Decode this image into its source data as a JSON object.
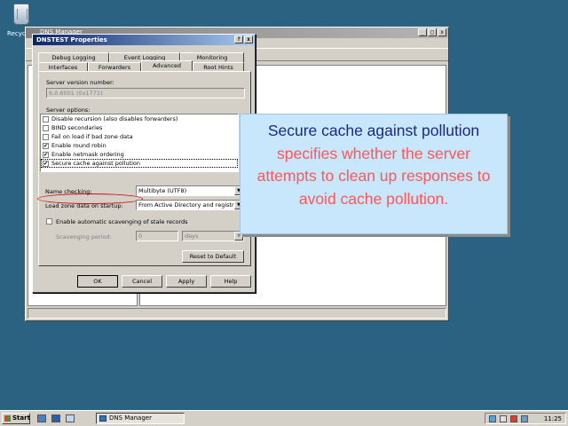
{
  "desktop": {
    "recycle_label": "Recycle Bin"
  },
  "mmc": {
    "title": "DNS Manager"
  },
  "dialog": {
    "title": "DNSTEST Properties",
    "tabs_row1": [
      "Debug Logging",
      "Event Logging",
      "Monitoring"
    ],
    "tabs_row2": [
      "Interfaces",
      "Forwarders",
      "Advanced",
      "Root Hints"
    ],
    "active_tab": "Advanced",
    "server_version_label": "Server version number:",
    "server_version_value": "6.0.6001 (0x1771)",
    "server_options_label": "Server options:",
    "options": [
      {
        "label": "Disable recursion (also disables forwarders)",
        "checked": false
      },
      {
        "label": "BIND secondaries",
        "checked": false
      },
      {
        "label": "Fail on load if bad zone data",
        "checked": false
      },
      {
        "label": "Enable round robin",
        "checked": true
      },
      {
        "label": "Enable netmask ordering",
        "checked": true
      },
      {
        "label": "Secure cache against pollution",
        "checked": true
      }
    ],
    "name_checking_label": "Name checking:",
    "name_checking_value": "Multibyte (UTF8)",
    "load_zone_label": "Load zone data on startup:",
    "load_zone_value": "From Active Directory and registry",
    "scavenging_label": "Enable automatic scavenging of stale records",
    "scavenging_period_label": "Scavenging period:",
    "scavenging_period_value": "0",
    "scavenging_unit": "days",
    "reset_button": "Reset to Default",
    "ok_button": "OK",
    "cancel_button": "Cancel",
    "apply_button": "Apply",
    "help_button": "Help"
  },
  "callout": {
    "emphasis": "Secure cache against pollution",
    "rest": " specifies whether the server attempts to clean up responses to avoid cache pollution."
  },
  "taskbar": {
    "start_label": "Start",
    "task_label": "DNS Manager",
    "clock": "11:25"
  },
  "colors": {
    "accent": "#1a2a80",
    "callout_text": "#ff5757",
    "callout_bg": "#c8e6fc",
    "desktop": "#2b6282"
  }
}
